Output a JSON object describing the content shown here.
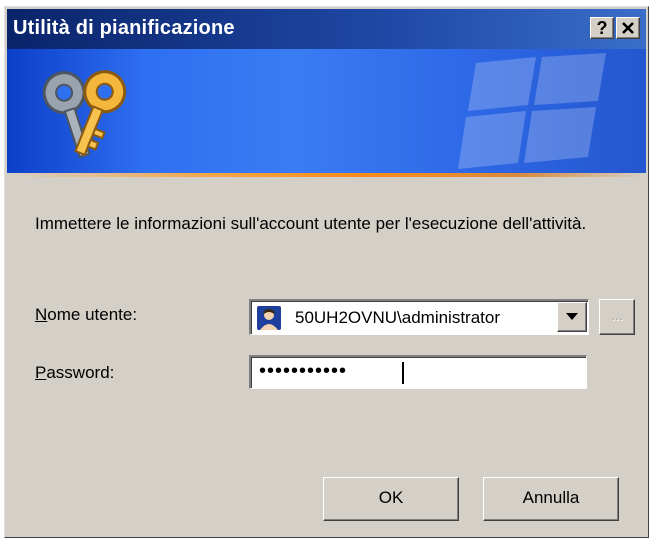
{
  "window": {
    "title": "Utilità di pianificazione",
    "help_label": "?",
    "close_label": "✕"
  },
  "banner": {
    "icon": "keys-icon",
    "watermark": "windows-flag-watermark"
  },
  "colors": {
    "titlebar": "#0a246a",
    "banner": "#3a7cf3",
    "accent_stripe": "#ff8c1a",
    "dialog_face": "#d4d0c8"
  },
  "description": "Immettere le informazioni sull'account utente per l'esecuzione dell'attività.",
  "username": {
    "label_access_key": "N",
    "label_rest": "ome utente:",
    "value": "50UH2OVNU\\administrator",
    "icon": "user-icon",
    "browse_label": "..."
  },
  "password": {
    "label_access_key": "P",
    "label_rest": "assword:",
    "masked_value": "•••••••••••"
  },
  "buttons": {
    "ok": "OK",
    "cancel": "Annulla"
  }
}
